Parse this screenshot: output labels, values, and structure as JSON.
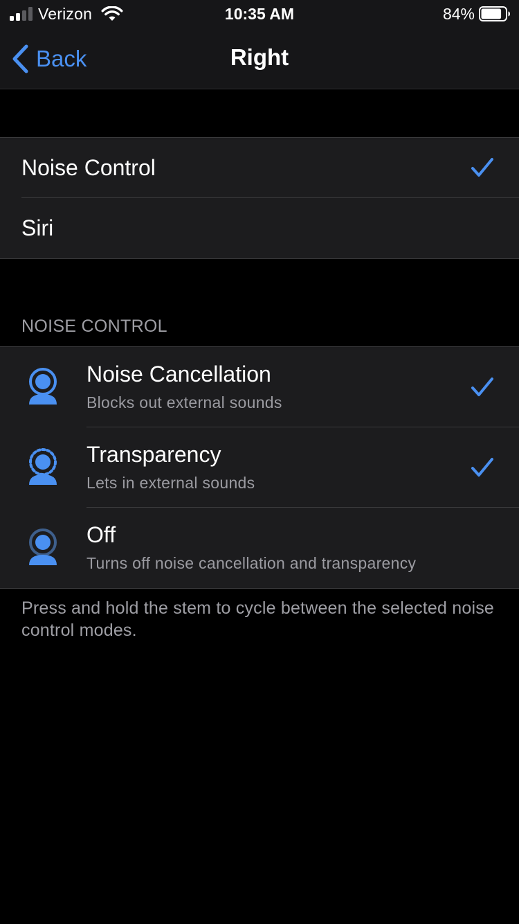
{
  "status_bar": {
    "carrier": "Verizon",
    "time": "10:35 AM",
    "battery_percent": "84%",
    "battery_level": 0.84,
    "signal_bars_filled": 2,
    "signal_bars_total": 4
  },
  "nav": {
    "back_label": "Back",
    "title": "Right"
  },
  "press_hold_options": [
    {
      "label": "Noise Control",
      "selected": true
    },
    {
      "label": "Siri",
      "selected": false
    }
  ],
  "noise_control": {
    "header": "NOISE CONTROL",
    "modes": [
      {
        "title": "Noise Cancellation",
        "subtitle": "Blocks out external sounds",
        "selected": true,
        "icon": "noise-cancellation-icon"
      },
      {
        "title": "Transparency",
        "subtitle": "Lets in external sounds",
        "selected": true,
        "icon": "transparency-icon"
      },
      {
        "title": "Off",
        "subtitle": "Turns off noise cancellation and transparency",
        "selected": false,
        "icon": "noise-off-icon"
      }
    ],
    "footer": "Press and hold the stem to cycle between the selected noise control modes."
  },
  "colors": {
    "accent": "#4a90f1",
    "background": "#000000",
    "cell": "#1c1c1e",
    "secondary_text": "#9e9ea4"
  }
}
